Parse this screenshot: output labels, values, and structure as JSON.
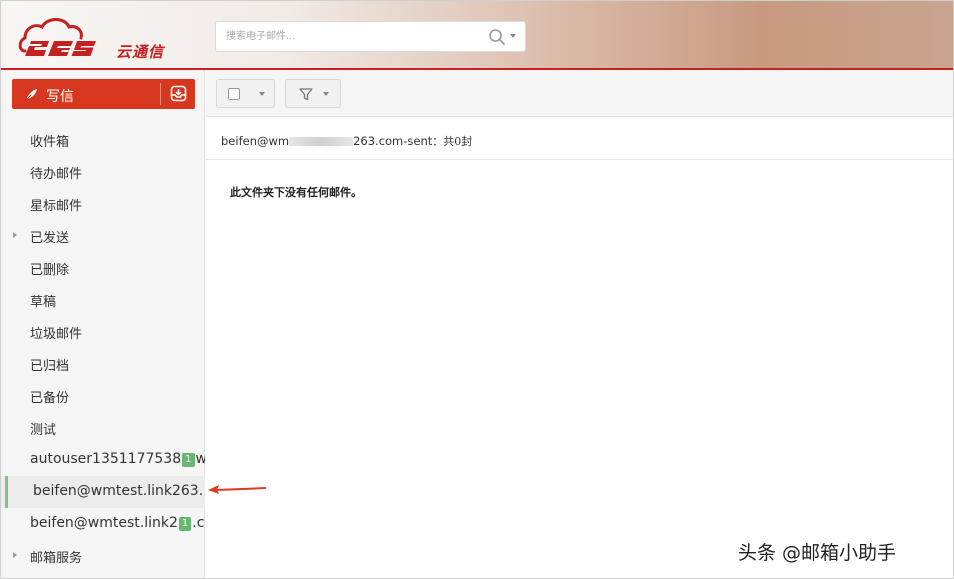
{
  "brand": {
    "logo_number": "263",
    "logo_text": "云通信",
    "accent": "#c9201f"
  },
  "search": {
    "placeholder": "搜索电子邮件...",
    "icon": "search-icon"
  },
  "compose": {
    "label": "写信",
    "icon": "feather-icon",
    "inbox_icon": "inbox-download-icon",
    "color": "#d8371f"
  },
  "folders": [
    {
      "label": "收件箱"
    },
    {
      "label": "待办邮件"
    },
    {
      "label": "星标邮件"
    },
    {
      "label": "已发送",
      "expandable": true
    },
    {
      "label": "已删除"
    },
    {
      "label": "草稿"
    },
    {
      "label": "垃圾邮件"
    },
    {
      "label": "已归档"
    },
    {
      "label": "已备份"
    },
    {
      "label": "测试"
    },
    {
      "label_pre": "autouser1351177538",
      "badge": "1",
      "label_post": "w"
    },
    {
      "label": "beifen@wmtest.link263.",
      "active": true
    },
    {
      "label_pre": "beifen@wmtest.link2",
      "badge": "1",
      "label_post": ".c"
    },
    {
      "label": "邮箱服务",
      "expandable": true
    }
  ],
  "toolbar": {
    "select_icon": "checkbox-icon",
    "filter_icon": "filter-icon"
  },
  "main": {
    "path_prefix": "beifen@wm",
    "path_suffix": "263.com-sent",
    "count_text": "：共0封",
    "empty_message": "此文件夹下没有任何邮件。"
  },
  "watermark": "头条 @邮箱小助手"
}
